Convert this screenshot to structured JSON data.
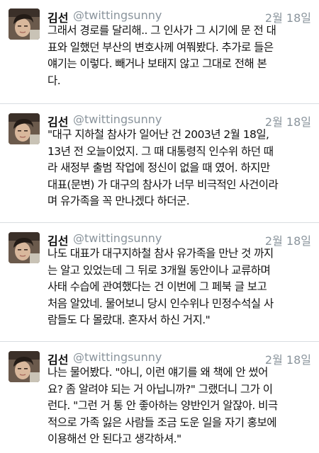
{
  "tweets": [
    {
      "author": "김선",
      "handle": "@twittingsunny",
      "date": "2월 18일",
      "lines": [
        "그래서 경로를 달리해.. 그 인사가 그 시기에 문 전 대",
        "표와 일했던 부산의 변호사께 여쭤봤다. 추가로 들은",
        "얘기는 이렇다. 빼거나 보태지 않고 그대로 전해 본",
        "다."
      ]
    },
    {
      "author": "김선",
      "handle": "@twittingsunny",
      "date": "2월 18일",
      "lines": [
        "\"대구 지하철 참사가 일어난 건 2003년 2월 18일,",
        "13년 전 오늘이었지. 그 때 대통령직 인수위 하던 때",
        "라 새정부 출범 작업에 정신이 없을 때 였어. 하지만",
        "대표(문변) 가 대구의 참사가 너무 비극적인 사건이라",
        "며 유가족을 꼭 만나겠다 하더군."
      ]
    },
    {
      "author": "김선",
      "handle": "@twittingsunny",
      "date": "2월 18일",
      "lines": [
        "나도 대표가 대구지하철 참사 유가족을 만난 것 까지",
        "는 알고 있었는데 그 뒤로 3개월 동안이나 교류하며",
        "사태 수습에 관여했다는 건 이번에 그 페북 글 보고",
        "처음 알았네. 물어보니 당시 인수위나 민정수석실 사",
        "람들도 다 몰랐대. 혼자서 하신 거지.\""
      ]
    },
    {
      "author": "김선",
      "handle": "@twittingsunny",
      "date": "2월 18일",
      "lines": [
        "나는 물어봤다. \"아니, 이런 얘기를 왜 책에 안 썼어",
        "요? 좀 알려야 되는 거 아닙니까?\" 그랬더니 그가 이",
        "런다. \"그런 거 통 안 좋아하는 양반인거 알잖아. 비극",
        "적으로 가족 잃은 사람들 조금 도운 일을 자기 홍보에",
        "이용해선 안 된다고 생각하셔.\""
      ]
    }
  ]
}
